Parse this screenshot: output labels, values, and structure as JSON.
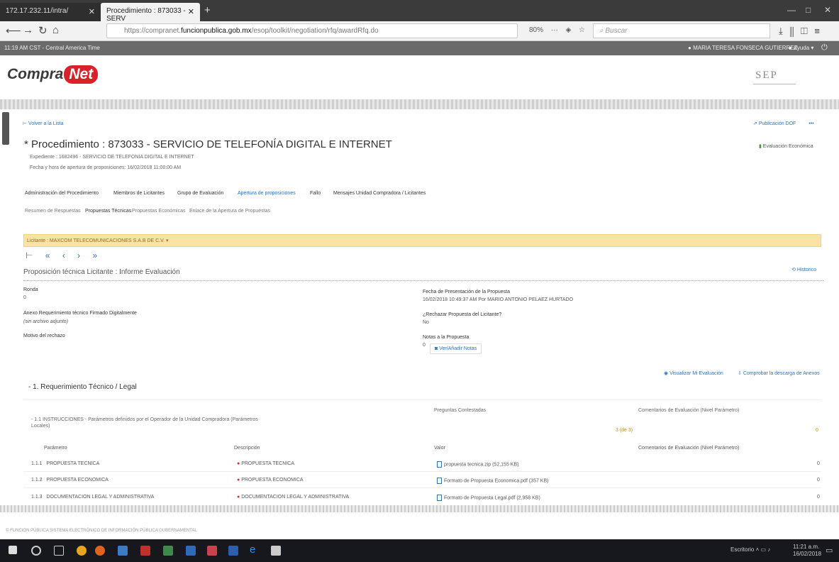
{
  "browser": {
    "tab1": "172.17.232.11/intra/",
    "tab2": "Procedimiento : 873033 - SERV",
    "url_prefix": "https://compranet.",
    "url_domain": "funcionpublica.gob.mx",
    "url_path": "/esop/toolkit/negotiation/rfq/awardRfq.do",
    "zoom": "80%",
    "search_placeholder": "Buscar"
  },
  "status": {
    "time": "11:19 AM CST - Central America Time",
    "user": "MARIA TERESA FONSECA GUTIERREZ",
    "help": "Ayuda"
  },
  "header": {
    "logo_a": "Compra",
    "logo_b": "Net",
    "sep": "SEP"
  },
  "nav": {
    "back": "Volver a la Lista",
    "publish": "Publicación DOF",
    "economic_eval": "Evaluación Económica"
  },
  "procedure": {
    "title": "Procedimiento : 873033 - SERVICIO DE TELEFONÍA DIGITAL E INTERNET",
    "expediente": "Expediente : 1682496 - SERVICIO DE TELEFONIA DIGITAL E INTERNET",
    "fecha": "Fecha y hora de apertura de proposiciones: 16/02/2018 11:00:00 AM"
  },
  "main_tabs": [
    "Administración del Procedimiento",
    "Miembros de Licitantes",
    "Grupo de Evaluación",
    "Apertura de proposiciones",
    "Fallo",
    "Mensajes Unidad Compradora / Licitantes"
  ],
  "sub_tabs": [
    "Resumen de Respuestas",
    "Propuestas Técnicas",
    "Propuestas Económicas",
    "Enlace de la Apertura de Propuestas"
  ],
  "licitante": "Licitante : MAXCOM TELECOMUNICACIONES S.A.B DE C.V.",
  "pager": [
    "⊢",
    "«",
    "‹",
    "›",
    "»"
  ],
  "proposal": {
    "title": "Proposición técnica Licitante : Informe Evaluación",
    "history": "Historico",
    "ronda_label": "Ronda",
    "ronda_value": "0",
    "anexo_label": "Anexo Requerimiento técnico Firmado Digitalmente",
    "anexo_value": "(sin archivo adjunto)",
    "motivo_label": "Motivo del rechazo",
    "fecha_label": "Fecha de Presentación de la Propuesta",
    "fecha_value": "16/02/2018 10:49:37 AM Por MARIO ANTONIO PELAEZ HURTADO",
    "rechazar_label": "¿Rechazar Propuesta del Licitante?",
    "rechazar_value": "No",
    "notas_label": "Notas a la Propuesta",
    "notas_value": "0",
    "notas_button": "Ver/Añadir Notas"
  },
  "actions": {
    "view_eval": "Visualizar Mi Evaluación",
    "check_dl": "Comprobar la descarga de Anexos"
  },
  "requirement": {
    "title": "1. Requerimiento Técnico / Legal",
    "sub": "1.1 INSTRUCCIONES - Parámetros definidos por el Operador de la Unidad Compradora (Parámetros Locales)",
    "answered_label": "Preguntas Contestadas",
    "answered_value": "3 (de 3)",
    "comments_label": "Comentarios de Evaluación (Nivel Parámetro)",
    "comments_value": "0"
  },
  "table": {
    "headers": [
      "Parámetro",
      "Descripción",
      "Valor",
      "Comentarios de Evaluación (Nivel Parámetro)"
    ],
    "rows": [
      {
        "num": "1.1.1",
        "param": "PROPUESTA TECNICA",
        "desc": "PROPUESTA TECNICA",
        "file": "propuesta tecnica.zip (52,155 KB)",
        "comments": "0"
      },
      {
        "num": "1.1.2",
        "param": "PROPUESTA ECONOMICA",
        "desc": "PROPUESTA ECONOMICA",
        "file": "Formato de Propuesta Economica.pdf (357 KB)",
        "comments": "0"
      },
      {
        "num": "1.1.3",
        "param": "DOCUMENTACION LEGAL Y ADMINISTRATIVA",
        "desc": "DOCUMENTACION LEGAL Y ADMINISTRATIVA",
        "file": "Formato de Propuesta Legal.pdf (2,958 KB)",
        "comments": "0"
      }
    ]
  },
  "footer": {
    "note": "© FUNCION PÚBLICA SISTEMA ELECTRÓNICO DE INFORMACIÓN PÚBLICA GUBERNAMENTAL"
  },
  "taskbar": {
    "lang": "Escritorio",
    "time": "11:21 a.m.",
    "date": "16/02/2018"
  },
  "colors": {
    "accent": "#2b73b7",
    "licitante_bar": "#fbe3a6",
    "logo_red": "#d8212a"
  }
}
